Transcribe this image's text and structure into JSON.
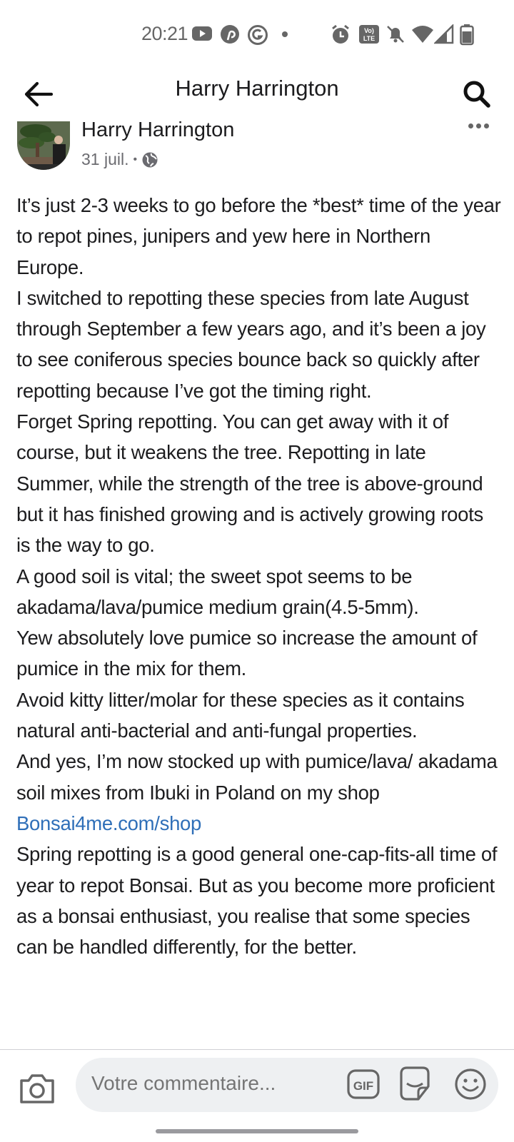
{
  "status_bar": {
    "time": "20:21",
    "icons": [
      "youtube-icon",
      "pinterest-icon",
      "circle-g-icon",
      "dot-icon",
      "alarm-icon",
      "volte-icon",
      "mute-icon",
      "wifi-icon",
      "signal-icon",
      "battery-icon"
    ]
  },
  "header": {
    "title": "Harry Harrington",
    "back_icon": "back-arrow-icon",
    "search_icon": "search-icon"
  },
  "post": {
    "author": "Harry Harrington",
    "date": "31 juil.",
    "separator": "•",
    "privacy_icon": "globe-icon",
    "more_icon": "more-options-icon",
    "paragraphs": {
      "p1": "It’s just 2-3 weeks to go before the *best* time of the year to repot pines, junipers and yew here in Northern Europe.",
      "p2": "I switched to repotting these species from late August through September a few years ago, and it’s been a joy to see coniferous species bounce back so quickly after repotting because I’ve got the timing right.",
      "p3": "Forget Spring repotting. You can get away with it of course, but it weakens the tree. Repotting in late Summer, while the strength of the tree is above-ground but it has finished growing and is actively growing roots is the way to go.",
      "p4": "A good soil is vital; the sweet spot seems to be akadama/lava/pumice medium grain(4.5-5mm).",
      "p5": "Yew absolutely love pumice so increase the amount of pumice in the mix for them.",
      "p6": "Avoid kitty litter/molar for these species as it contains natural anti-bacterial and anti-fungal properties.",
      "p7": "And yes, I’m now stocked up with pumice/lava/ akadama soil mixes from Ibuki in Poland on my shop",
      "link": "Bonsai4me.com/shop",
      "p8": "Spring repotting is a good general one-cap-fits-all time of year to repot Bonsai. But as you become more proficient as a bonsai enthusiast, you realise that some species can be handled differently, for the better."
    }
  },
  "comment_bar": {
    "placeholder": "Votre commentaire...",
    "camera_icon": "camera-icon",
    "gif_label": "GIF",
    "sticker_icon": "sticker-icon",
    "emoji_icon": "emoji-icon"
  },
  "colors": {
    "link": "#2f6fb8",
    "text": "#1c1c1e",
    "muted": "#6b6b70",
    "input_bg": "#eef0f2"
  }
}
